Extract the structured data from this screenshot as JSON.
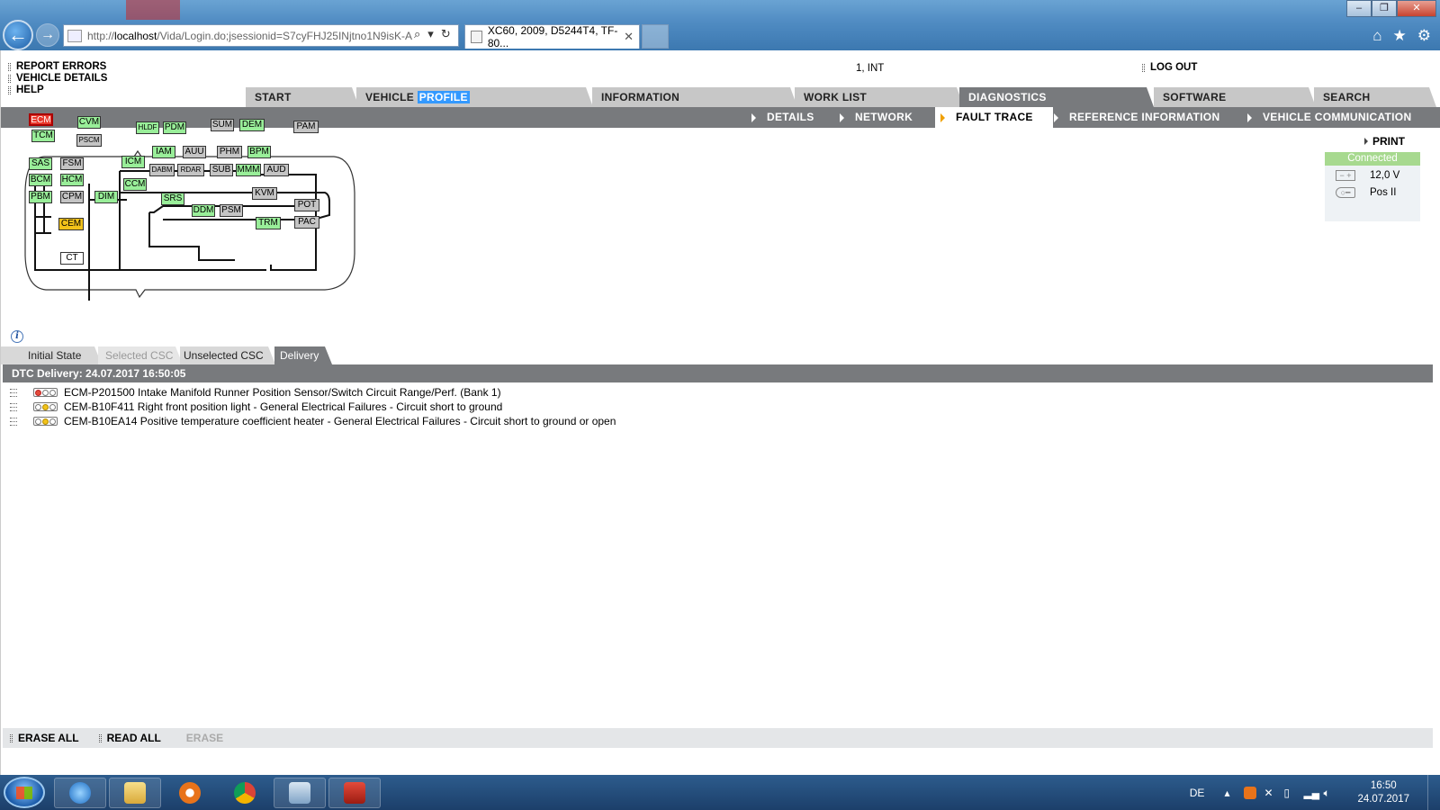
{
  "browser": {
    "url_prefix": "http://",
    "url_host": "localhost",
    "url_rest": "/Vida/Login.do;jsessionid=S7cyFHJ25INjtno1N9isK-A",
    "tab_title": "XC60, 2009, D5244T4, TF-80...",
    "tab_close": "✕"
  },
  "left_menu": {
    "items": [
      {
        "label": "REPORT ERRORS"
      },
      {
        "label": "VEHICLE DETAILS"
      },
      {
        "label": "HELP"
      }
    ]
  },
  "user_info": "1, INT",
  "logout_label": "LOG OUT",
  "main_tabs": [
    {
      "label": "START"
    },
    {
      "label": "VEHICLE",
      "highlight": "PROFILE"
    },
    {
      "label": "INFORMATION"
    },
    {
      "label": "WORK LIST"
    },
    {
      "label": "DIAGNOSTICS",
      "active": true
    },
    {
      "label": "SOFTWARE"
    },
    {
      "label": "SEARCH"
    }
  ],
  "sub_tabs": [
    {
      "label": "DETAILS"
    },
    {
      "label": "NETWORK"
    },
    {
      "label": "FAULT TRACE",
      "active": true
    },
    {
      "label": "REFERENCE INFORMATION"
    },
    {
      "label": "VEHICLE COMMUNICATION"
    }
  ],
  "print_label": "PRINT",
  "status": {
    "connection": "Connected",
    "voltage": "12,0 V",
    "ignition": "Pos II",
    "connection_color": "#a7d98f"
  },
  "network": {
    "nodes": [
      {
        "label": "ECM",
        "state": "red"
      },
      {
        "label": "TCM",
        "state": "green"
      },
      {
        "label": "CVM",
        "state": "green"
      },
      {
        "label": "PSCM",
        "state": "grey"
      },
      {
        "label": "HLDF",
        "state": "green"
      },
      {
        "label": "PDM",
        "state": "green"
      },
      {
        "label": "SUM",
        "state": "grey"
      },
      {
        "label": "DEM",
        "state": "green"
      },
      {
        "label": "PAM",
        "state": "grey"
      },
      {
        "label": "SAS",
        "state": "green"
      },
      {
        "label": "FSM",
        "state": "grey"
      },
      {
        "label": "ICM",
        "state": "green"
      },
      {
        "label": "IAM",
        "state": "green"
      },
      {
        "label": "AUU",
        "state": "grey"
      },
      {
        "label": "PHM",
        "state": "grey"
      },
      {
        "label": "BPM",
        "state": "green"
      },
      {
        "label": "DABM",
        "state": "grey"
      },
      {
        "label": "RDAR",
        "state": "grey"
      },
      {
        "label": "SUB",
        "state": "grey"
      },
      {
        "label": "MMM",
        "state": "green"
      },
      {
        "label": "AUD",
        "state": "grey"
      },
      {
        "label": "BCM",
        "state": "green"
      },
      {
        "label": "HCM",
        "state": "green"
      },
      {
        "label": "CCM",
        "state": "green"
      },
      {
        "label": "KVM",
        "state": "grey"
      },
      {
        "label": "PBM",
        "state": "green"
      },
      {
        "label": "CPM",
        "state": "grey"
      },
      {
        "label": "DIM",
        "state": "green"
      },
      {
        "label": "SRS",
        "state": "green"
      },
      {
        "label": "POT",
        "state": "grey"
      },
      {
        "label": "DDM",
        "state": "green"
      },
      {
        "label": "PSM",
        "state": "grey"
      },
      {
        "label": "CEM",
        "state": "yellow"
      },
      {
        "label": "TRM",
        "state": "green"
      },
      {
        "label": "PAC",
        "state": "grey"
      },
      {
        "label": "CT",
        "state": "white"
      }
    ]
  },
  "csc_tabs": [
    {
      "label": "Initial State"
    },
    {
      "label": "Selected CSC",
      "disabled": true
    },
    {
      "label": "Unselected CSC"
    },
    {
      "label": "Delivery",
      "active": true
    }
  ],
  "dtc_header": "DTC Delivery: 24.07.2017 16:50:05",
  "dtc_items": [
    {
      "text": "ECM-P201500 Intake Manifold Runner Position Sensor/Switch Circuit Range/Perf. (Bank 1)",
      "light": "red"
    },
    {
      "text": "CEM-B10F411 Right front position light - General Electrical Failures - Circuit short to ground",
      "light": "yellow"
    },
    {
      "text": "CEM-B10EA14 Positive temperature coefficient heater - General Electrical Failures - Circuit short to ground or open",
      "light": "yellow"
    }
  ],
  "footer": {
    "erase_all": "ERASE ALL",
    "read_all": "READ ALL",
    "erase": "ERASE"
  },
  "taskbar": {
    "lang": "DE",
    "time": "16:50",
    "date": "24.07.2017"
  }
}
